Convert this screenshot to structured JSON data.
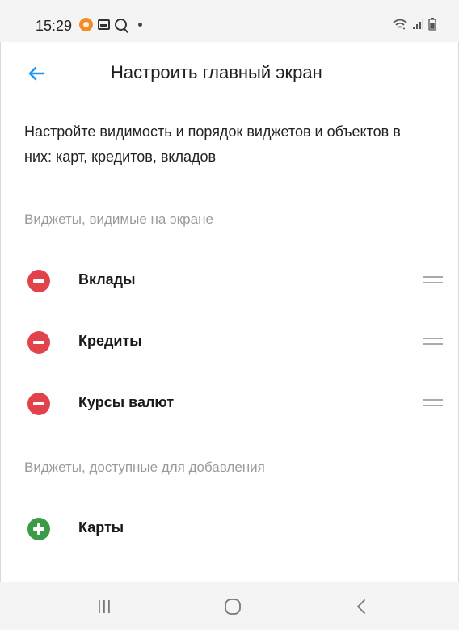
{
  "status_bar": {
    "time": "15:29",
    "icons": [
      "notification-dot-icon",
      "gallery-icon",
      "search-icon",
      "more-dot-icon",
      "wifi-icon",
      "signal-icon",
      "battery-icon"
    ]
  },
  "app_bar": {
    "back_icon": "arrow-left-icon",
    "title": "Настроить главный экран"
  },
  "description": "Настройте видимость и порядок виджетов и объектов в них: карт, кредитов, вкладов",
  "visible_section": {
    "header": "Виджеты, видимые на экране",
    "items": [
      {
        "label": "Вклады",
        "action_icon": "remove-circle-icon",
        "handle_icon": "drag-handle-icon"
      },
      {
        "label": "Кредиты",
        "action_icon": "remove-circle-icon",
        "handle_icon": "drag-handle-icon"
      },
      {
        "label": "Курсы валют",
        "action_icon": "remove-circle-icon",
        "handle_icon": "drag-handle-icon"
      }
    ]
  },
  "available_section": {
    "header": "Виджеты, доступные для добавления",
    "items": [
      {
        "label": "Карты",
        "action_icon": "add-circle-icon"
      }
    ]
  },
  "nav_bar": {
    "icons": [
      "recent-apps-icon",
      "home-icon",
      "back-nav-icon"
    ]
  },
  "colors": {
    "accent": "#2196f3",
    "remove": "#e2434b",
    "add": "#3a9c46",
    "section_header": "#9a9a9a",
    "bars_bg": "#f4f4f4"
  }
}
